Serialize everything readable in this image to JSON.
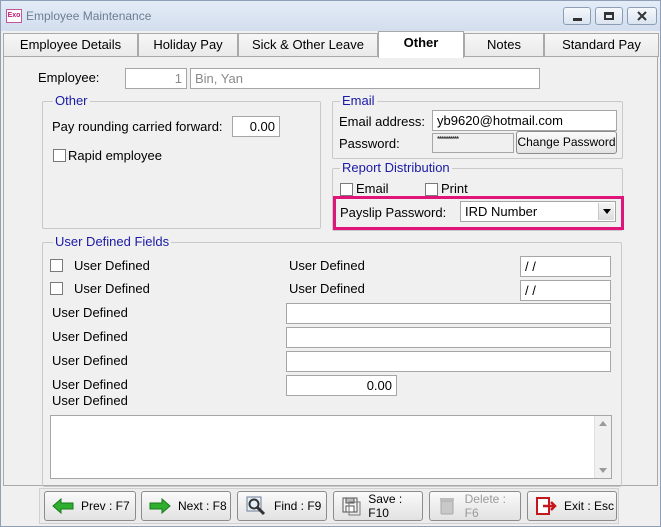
{
  "window": {
    "app_icon_text": "Exo",
    "title": "Employee Maintenance"
  },
  "tabs": [
    {
      "label": "Employee Details"
    },
    {
      "label": "Holiday Pay"
    },
    {
      "label": "Sick & Other Leave"
    },
    {
      "label": "Other"
    },
    {
      "label": "Notes"
    },
    {
      "label": "Standard Pay"
    }
  ],
  "active_tab": "Other",
  "employee": {
    "label": "Employee:",
    "number": "1",
    "name": "Bin, Yan"
  },
  "other_group": {
    "title": "Other",
    "pay_rounding_label": "Pay rounding carried forward:",
    "pay_rounding_value": "0.00",
    "rapid_employee_label": "Rapid employee",
    "rapid_employee_checked": false
  },
  "email_group": {
    "title": "Email",
    "email_label": "Email address:",
    "email_value": "yb9620@hotmail.com",
    "password_label": "Password:",
    "password_value": "**********",
    "change_password_label": "Change Password"
  },
  "report_group": {
    "title": "Report Distribution",
    "email_label": "Email",
    "email_checked": false,
    "print_label": "Print",
    "print_checked": false,
    "payslip_password_label": "Payslip Password:",
    "payslip_password_value": "IRD Number",
    "highlight_color": "#e0157a"
  },
  "udf_group": {
    "title": "User Defined Fields",
    "check_rows": [
      {
        "label": "User Defined",
        "checked": false
      },
      {
        "label": "User Defined",
        "checked": false
      }
    ],
    "date_rows": [
      {
        "label": "User Defined",
        "value": " / /"
      },
      {
        "label": "User Defined",
        "value": " / /"
      }
    ],
    "text_rows": [
      {
        "label": "User Defined",
        "value": ""
      },
      {
        "label": "User Defined",
        "value": ""
      },
      {
        "label": "User Defined",
        "value": ""
      }
    ],
    "number_row": {
      "label": "User Defined",
      "value": "0.00"
    },
    "memo_row": {
      "label": "User Defined",
      "value": ""
    }
  },
  "footer": {
    "prev": "Prev : F7",
    "next": "Next : F8",
    "find": "Find : F9",
    "save": "Save : F10",
    "delete": "Delete : F6",
    "exit": "Exit : Esc"
  }
}
